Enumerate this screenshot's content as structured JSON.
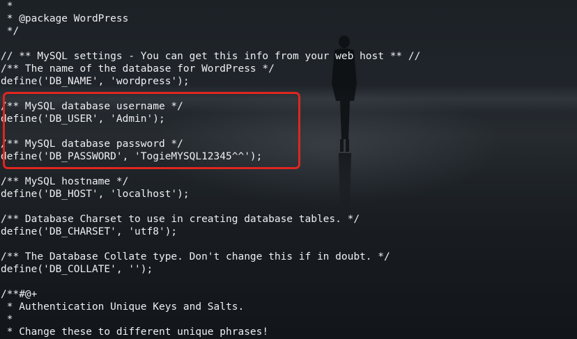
{
  "editor": {
    "lines": [
      " *",
      " * @package WordPress",
      " */",
      "",
      "// ** MySQL settings - You can get this info from your web host ** //",
      "/** The name of the database for WordPress */",
      "define('DB_NAME', 'wordpress');",
      "",
      "/** MySQL database username */",
      "define('DB_USER', 'Admin');",
      "",
      "/** MySQL database password */",
      "define('DB_PASSWORD', 'TogieMYSQL12345^^');",
      "",
      "/** MySQL hostname */",
      "define('DB_HOST', 'localhost');",
      "",
      "/** Database Charset to use in creating database tables. */",
      "define('DB_CHARSET', 'utf8');",
      "",
      "/** The Database Collate type. Don't change this if in doubt. */",
      "define('DB_COLLATE', '');",
      "",
      "/**#@+",
      " * Authentication Unique Keys and Salts.",
      " *",
      " * Change these to different unique phrases!"
    ]
  },
  "colors": {
    "text": "#eef0f2",
    "highlight_border": "#e0261f",
    "background": "#1c2126"
  }
}
